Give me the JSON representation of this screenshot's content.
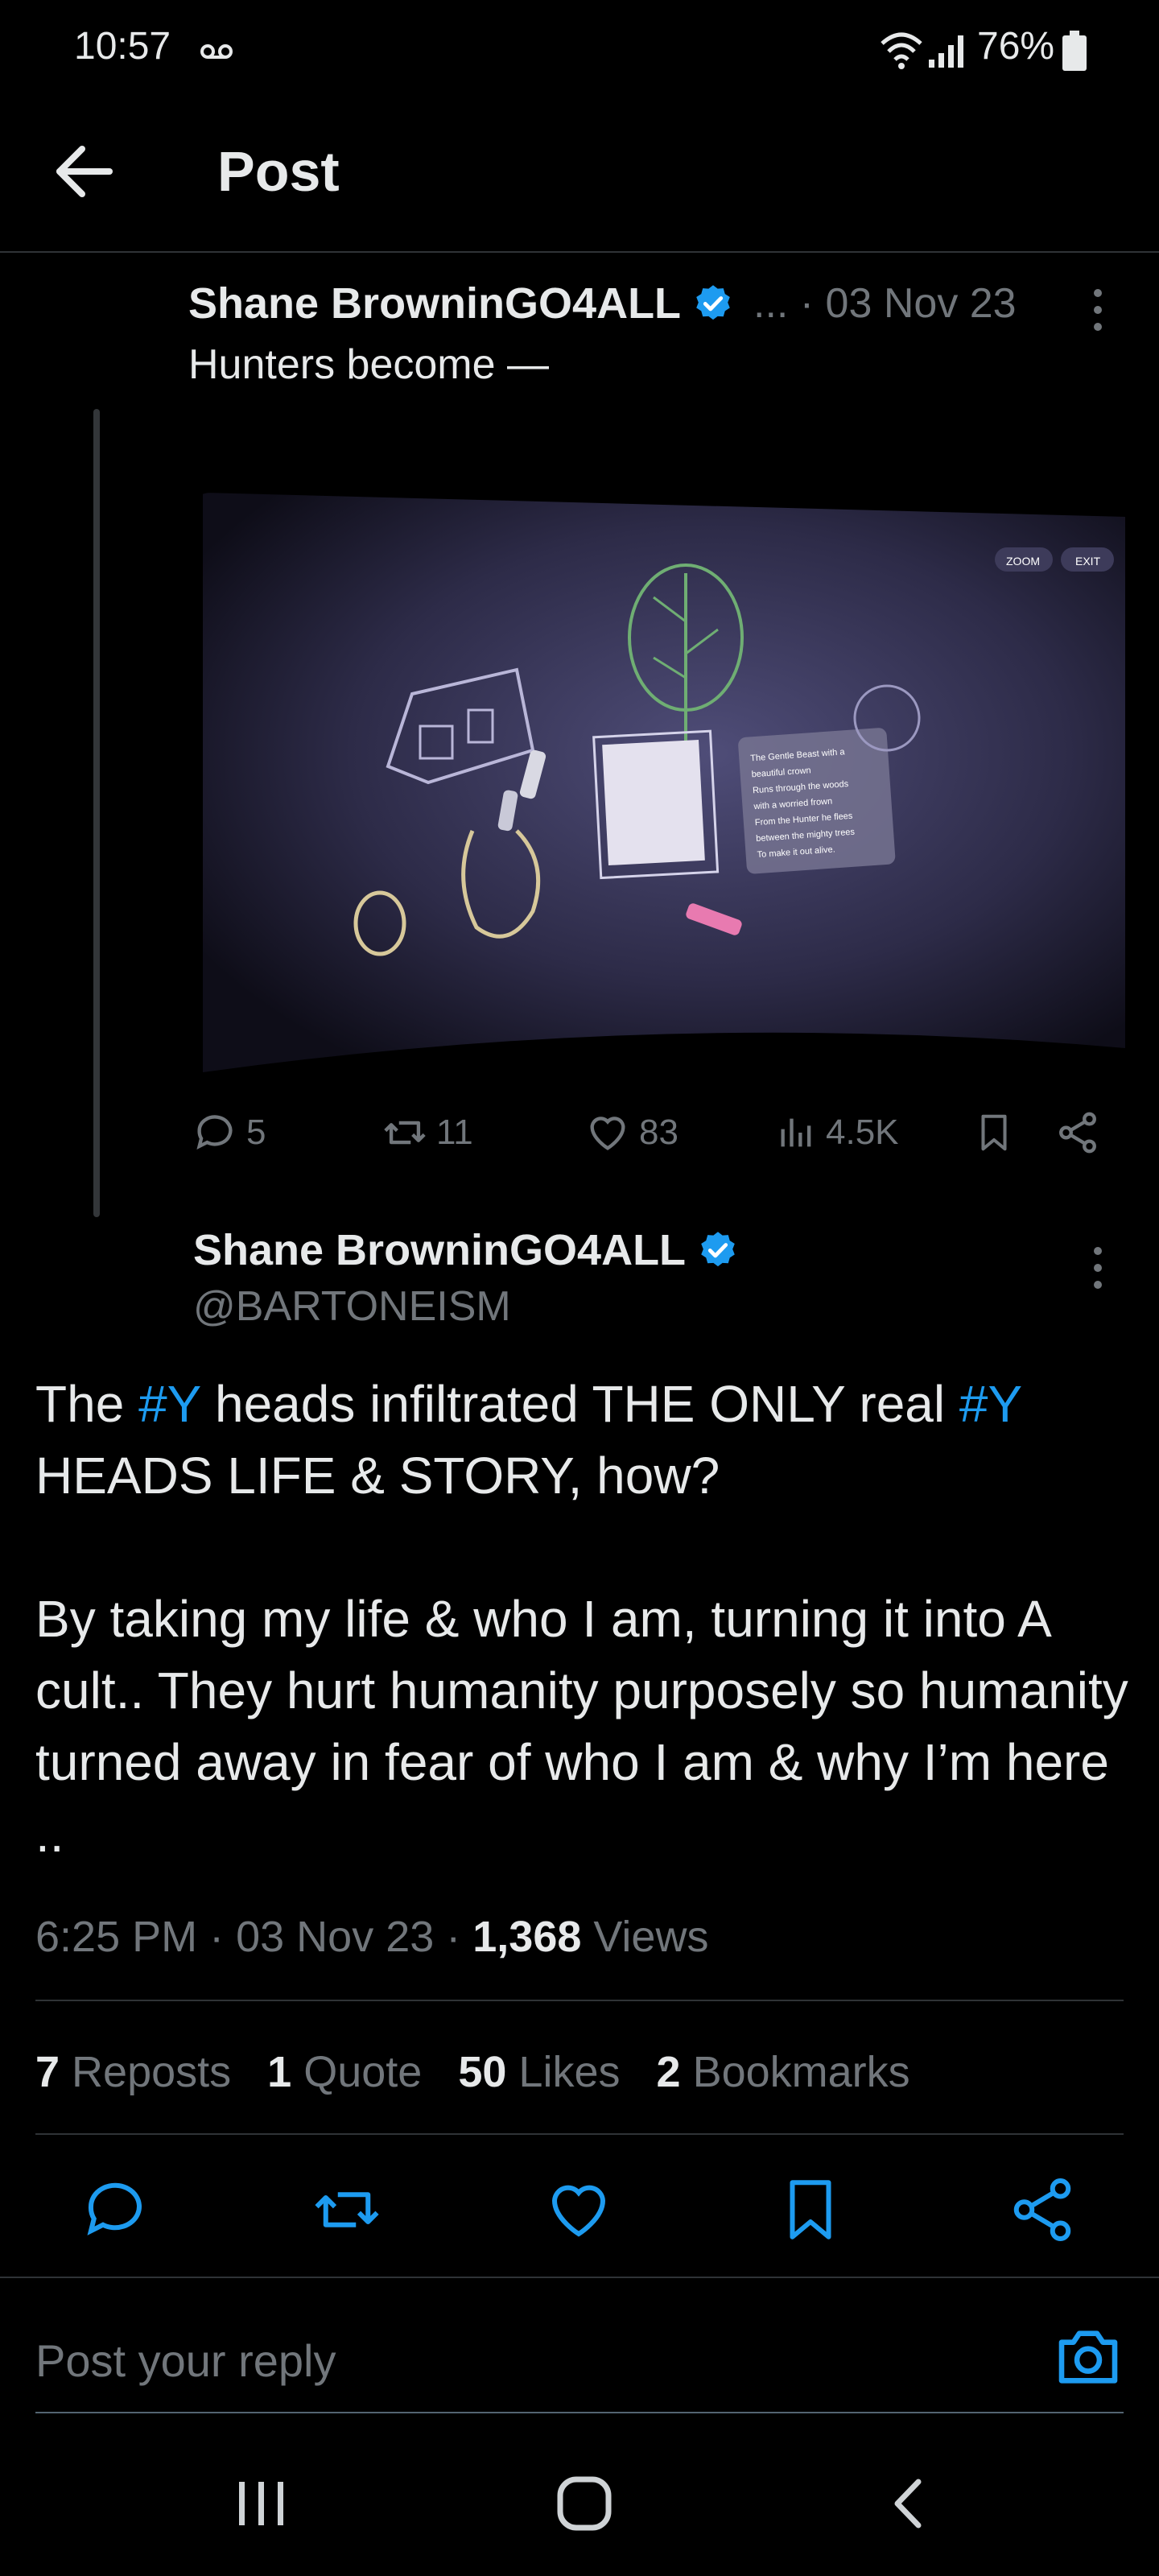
{
  "status_bar": {
    "time": "10:57",
    "battery": "76%"
  },
  "header": {
    "title": "Post"
  },
  "parent_post": {
    "author": "Shane BrowninGO4ALL",
    "meta": "... · 03 Nov 23",
    "text": "Hunters become —",
    "actions": {
      "replies": "5",
      "reposts": "11",
      "likes": "83",
      "views": "4.5K"
    },
    "media": {
      "zoom": "ZOOM",
      "exit": "EXIT",
      "poem": [
        "The Gentle Beast with a",
        "beautiful crown",
        "Runs through the woods",
        "with a worried frown",
        "From the Hunter he flees",
        "between the mighty trees",
        "To make it out alive."
      ]
    }
  },
  "post": {
    "author": "Shane BrowninGO4ALL",
    "handle": "@BARTONEISM",
    "p1": {
      "a": "The ",
      "h1": "#Y",
      "b": " heads infiltrated THE ONLY real ",
      "h2": "#Y",
      "c": " HEADS LIFE & STORY, how?"
    },
    "p2": "By taking my life & who I am, turning it into A cult.. They hurt humanity purposely so humanity turned away in fear of who I am & why I’m here ..",
    "time": "6:25 PM · 03 Nov 23 · ",
    "views_count": "1,368",
    "views_label": " Views",
    "stats": {
      "reposts": "7",
      "reposts_label": " Reposts",
      "quotes": "1",
      "quotes_label": " Quote",
      "likes": "50",
      "likes_label": " Likes",
      "bookmarks": "2",
      "bookmarks_label": " Bookmarks"
    }
  },
  "reply": {
    "placeholder": "Post your reply"
  },
  "colors": {
    "background": "#000000",
    "text": "#e7e9ea",
    "muted": "#71767b",
    "accent": "#1d9bf0",
    "divider": "#2f3336"
  },
  "icons": [
    "back-arrow-icon",
    "verified-icon",
    "more-icon",
    "reply-icon",
    "repost-icon",
    "like-icon",
    "views-icon",
    "bookmark-icon",
    "share-icon",
    "camera-icon",
    "recents-icon",
    "home-icon",
    "nav-back-icon"
  ]
}
